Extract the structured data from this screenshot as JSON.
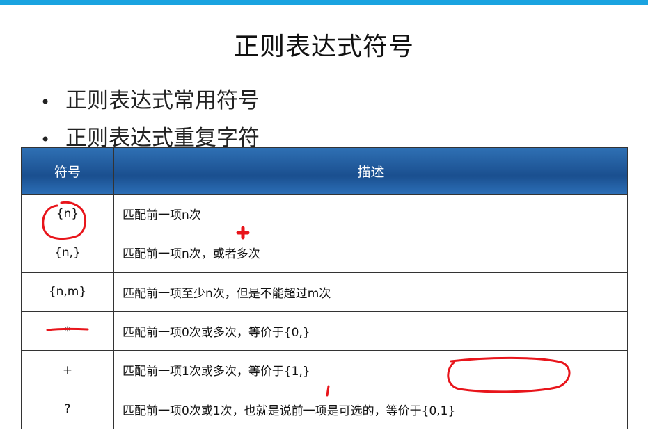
{
  "slide": {
    "title": "正则表达式符号",
    "bullets": [
      "正则表达式常用符号",
      "正则表达式重复字符"
    ]
  },
  "table": {
    "headers": [
      "符号",
      "描述"
    ],
    "rows": [
      {
        "symbol": "{n}",
        "description": "匹配前一项n次"
      },
      {
        "symbol": "{n,}",
        "description": "匹配前一项n次，或者多次"
      },
      {
        "symbol": "{n,m}",
        "description": "匹配前一项至少n次，但是不能超过m次"
      },
      {
        "symbol": "*",
        "description": "匹配前一项0次或多次，等价于{0,}"
      },
      {
        "symbol": "+",
        "description": "匹配前一项1次或多次，等价于{1,}"
      },
      {
        "symbol": "?",
        "description": "匹配前一项0次或1次，也就是说前一项是可选的，等价于{0,1}"
      }
    ]
  },
  "colors": {
    "topbar": "#1aa3e0",
    "header": "#1f5a9c",
    "annotation": "#e8151b"
  }
}
